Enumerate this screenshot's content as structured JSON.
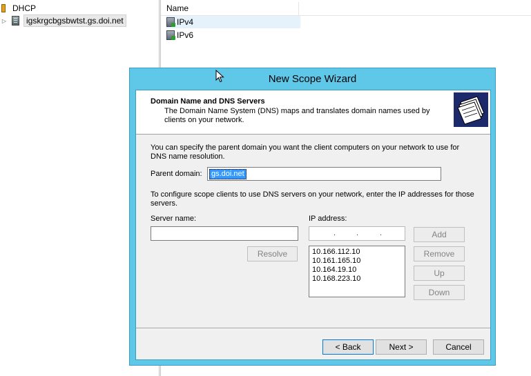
{
  "tree": {
    "root_label": "DHCP",
    "server_label": "igskrgcbgsbwtst.gs.doi.net"
  },
  "list": {
    "column_name": "Name",
    "items": [
      {
        "label": "IPv4"
      },
      {
        "label": "IPv6"
      }
    ]
  },
  "wizard": {
    "title": "New Scope Wizard",
    "header_title": "Domain Name and DNS Servers",
    "header_desc": "The Domain Name System (DNS) maps and translates domain names used by clients on your network.",
    "intro_text": "You can specify the parent domain you want the client computers on your network to use for DNS name resolution.",
    "parent_domain_label": "Parent domain:",
    "parent_domain_value": "gs.doi.net",
    "dns_text": "To configure scope clients to use DNS servers on your network, enter the IP addresses for those servers.",
    "server_name_label": "Server name:",
    "server_name_value": "",
    "ip_address_label": "IP address:",
    "ip_dots": [
      ".",
      ".",
      "."
    ],
    "ip_list": [
      "10.166.112.10",
      "10.161.165.10",
      "10.164.19.10",
      "10.168.223.10"
    ],
    "buttons": {
      "resolve": "Resolve",
      "add": "Add",
      "remove": "Remove",
      "up": "Up",
      "down": "Down",
      "back": "< Back",
      "next": "Next >",
      "cancel": "Cancel"
    }
  },
  "colors": {
    "titlebar": "#5fc7e8",
    "selection": "#3399ff",
    "header_graphic": "#1c2a6c"
  }
}
